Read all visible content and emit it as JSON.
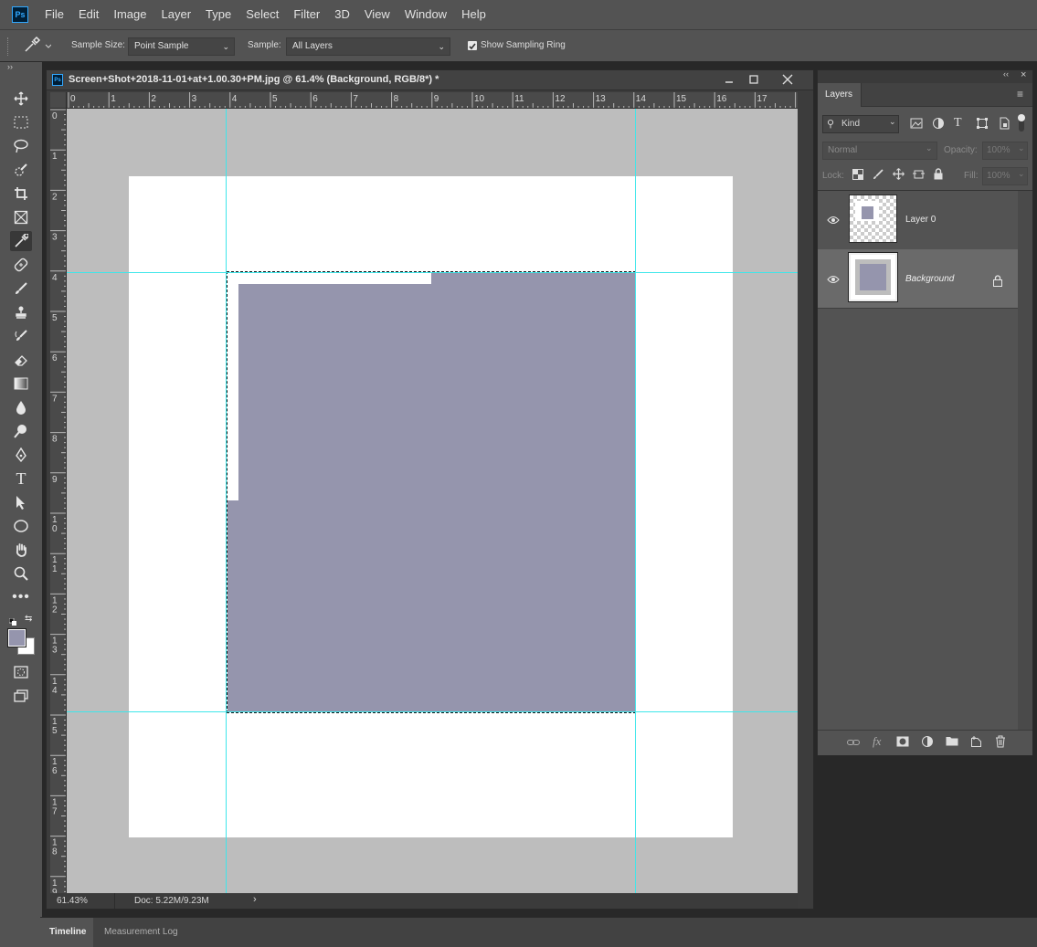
{
  "app": {
    "logo": "Ps"
  },
  "menu": [
    "File",
    "Edit",
    "Image",
    "Layer",
    "Type",
    "Select",
    "Filter",
    "3D",
    "View",
    "Window",
    "Help"
  ],
  "options": {
    "sample_size_label": "Sample Size:",
    "sample_size_value": "Point Sample",
    "sample_label": "Sample:",
    "sample_value": "All Layers",
    "show_ring_label": "Show Sampling Ring",
    "show_ring_checked": true
  },
  "document": {
    "title": "Screen+Shot+2018-11-01+at+1.00.30+PM.jpg @ 61.4% (Background, RGB/8*) *",
    "hruler_labels": [
      "0",
      "1",
      "2",
      "3",
      "4",
      "5",
      "6",
      "7",
      "8",
      "9",
      "10",
      "11",
      "12",
      "13",
      "14",
      "15",
      "16",
      "17"
    ],
    "vruler_labels": [
      "0",
      "1",
      "2",
      "3",
      "4",
      "5",
      "6",
      "7",
      "8",
      "9",
      "1 0",
      "1 1",
      "1 2",
      "1 3",
      "1 4",
      "1 5",
      "1 6",
      "1 7",
      "1 8",
      "1 9"
    ],
    "zoom": "61.43%",
    "doc_size": "Doc: 5.22M/9.23M",
    "fill_color": "#9595ad"
  },
  "layers_panel": {
    "tab": "Layers",
    "filter_kind": "Kind",
    "blend_mode": "Normal",
    "opacity_label": "Opacity:",
    "opacity_value": "100%",
    "lock_label": "Lock:",
    "fill_label": "Fill:",
    "fill_value": "100%",
    "layers": [
      {
        "name": "Layer 0",
        "visible": true,
        "selected": false,
        "locked": false
      },
      {
        "name": "Background",
        "visible": true,
        "selected": true,
        "locked": true
      }
    ]
  },
  "bottom_tabs": [
    "Timeline",
    "Measurement Log"
  ],
  "colors": {
    "accent_guides": "#3ee6ea",
    "foreground": "#9595ad",
    "background": "#ffffff"
  }
}
